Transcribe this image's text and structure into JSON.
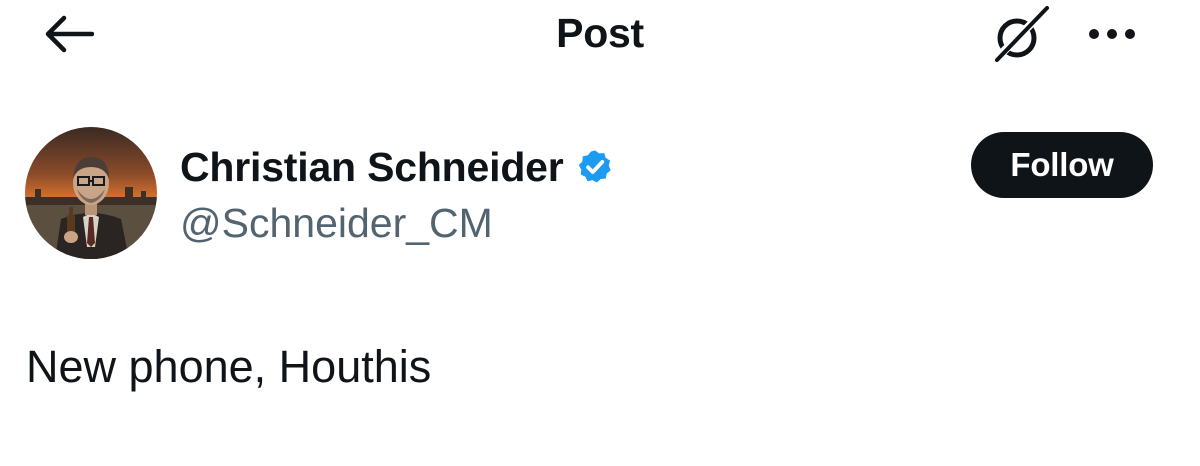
{
  "header": {
    "title": "Post",
    "back_icon": "arrow-left-icon",
    "grok_icon": "grok-icon",
    "more_icon": "more-horizontal-icon"
  },
  "author": {
    "display_name": "Christian Schneider",
    "handle": "@Schneider_CM",
    "verified": true,
    "verified_color": "#1d9bf0",
    "avatar_icon": "avatar-portrait"
  },
  "follow_button": {
    "label": "Follow",
    "background": "#0f1419",
    "text_color": "#ffffff"
  },
  "post": {
    "text": "New phone, Houthis"
  },
  "colors": {
    "primary_text": "#0f1419",
    "secondary_text": "#536471",
    "background": "#ffffff"
  }
}
